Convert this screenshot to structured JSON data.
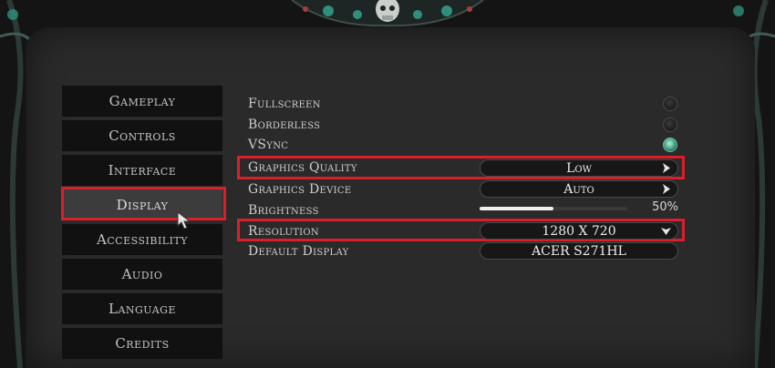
{
  "menu": {
    "items": [
      {
        "label": "Gameplay"
      },
      {
        "label": "Controls"
      },
      {
        "label": "Interface"
      },
      {
        "label": "Display"
      },
      {
        "label": "Accessibility"
      },
      {
        "label": "Audio"
      },
      {
        "label": "Language"
      },
      {
        "label": "Credits"
      }
    ],
    "active": "Display"
  },
  "settings": {
    "fullscreen": {
      "label": "Fullscreen",
      "enabled": false
    },
    "borderless": {
      "label": "Borderless",
      "enabled": false
    },
    "vsync": {
      "label": "VSync",
      "enabled": true
    },
    "graphics_quality": {
      "label": "Graphics Quality",
      "value": "Low"
    },
    "graphics_device": {
      "label": "Graphics Device",
      "value": "Auto"
    },
    "brightness": {
      "label": "Brightness",
      "value_text": "50%",
      "fraction": 0.5
    },
    "resolution": {
      "label": "Resolution",
      "value": "1280 X 720"
    },
    "default_display": {
      "label": "Default Display",
      "value": "ACER S271HL"
    }
  },
  "colors": {
    "highlight": "#d9202a",
    "toggle_on": "#3e9a7f",
    "accent_ornament": "#2f8f7a"
  }
}
